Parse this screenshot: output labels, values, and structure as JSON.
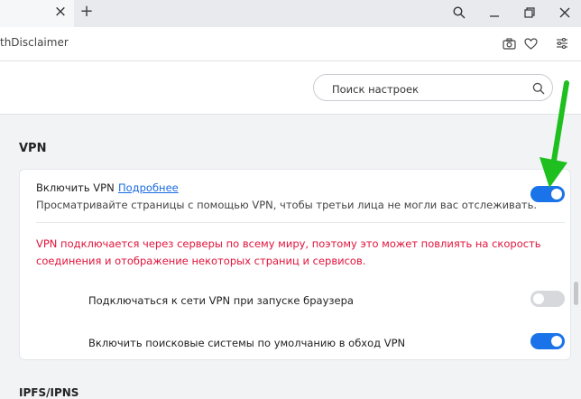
{
  "browser": {
    "url_text": "thDisclaimer"
  },
  "settings": {
    "search": {
      "placeholder": "Поиск настроек"
    },
    "vpn_section": {
      "title": "VPN",
      "enable_label": "Включить VPN",
      "more_link": "Подробнее",
      "description": "Просматривайте страницы с помощью VPN, чтобы третьи лица не могли вас отслеживать.",
      "enabled": true,
      "warning_line1": "VPN подключается через серверы по всему миру, поэтому это может повлиять на скорость",
      "warning_line2": "соединения и отображение некоторых страниц и сервисов.",
      "options": [
        {
          "label": "Подключаться к сети VPN при запуске браузера",
          "enabled": false
        },
        {
          "label": "Включить поисковые системы по умолчанию в обход VPN",
          "enabled": true
        }
      ]
    },
    "next_section_title": "IPFS/IPNS"
  },
  "colors": {
    "accent": "#1a73e8",
    "warning": "#e0143c",
    "annotation_arrow": "#1fbf1f"
  }
}
